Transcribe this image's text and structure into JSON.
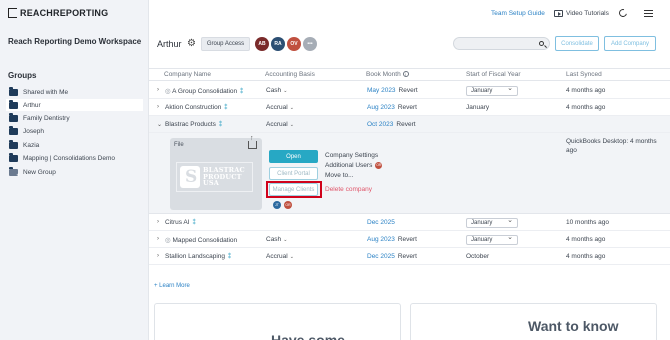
{
  "brand": {
    "name": "REACHREPORTING"
  },
  "sidebar": {
    "workspace": "Reach Reporting Demo Workspace",
    "groups_heading": "Groups",
    "items": [
      {
        "label": "Shared with Me"
      },
      {
        "label": "Arthur"
      },
      {
        "label": "Family Dentistry"
      },
      {
        "label": "Joseph"
      },
      {
        "label": "Kazia"
      },
      {
        "label": "Mapping | Consolidations Demo"
      },
      {
        "label": "New Group"
      }
    ]
  },
  "topbar": {
    "team_setup": "Team Setup Guide",
    "video_tutorials": "Video Tutorials"
  },
  "header": {
    "group_name": "Arthur",
    "group_access": "Group Access",
    "avatars": [
      {
        "initials": "AB",
        "color": "#7a2b2b"
      },
      {
        "initials": "RA",
        "color": "#2c4f73"
      },
      {
        "initials": "OV",
        "color": "#c0503f"
      },
      {
        "initials": "•••",
        "color": "#a6adb6"
      }
    ],
    "search_placeholder": "",
    "consolidate": "Consolidate",
    "add_company": "Add Company"
  },
  "table": {
    "columns": [
      "Company Name",
      "Accounting Basis",
      "Book Month",
      "Start of Fiscal Year",
      "Last Synced"
    ],
    "rows": [
      {
        "name": "A Group Consolidation",
        "basis": "Cash",
        "book": "May 2023",
        "revert": "Revert",
        "fiscal": "January",
        "synced": "4 months ago"
      },
      {
        "name": "Aktion Construction",
        "basis": "Accrual",
        "book": "Aug 2023",
        "revert": "Revert",
        "fiscal": "January",
        "synced": "4 months ago"
      },
      {
        "name": "Blastrac Products",
        "basis": "Accrual",
        "book": "Oct 2023",
        "revert": "Revert",
        "fiscal": "",
        "synced": ""
      },
      {
        "name": "Citrus AI",
        "basis": "",
        "book": "Dec 2025",
        "revert": "",
        "fiscal": "January",
        "synced": "10 months ago"
      },
      {
        "name": "Mapped Consolidation",
        "basis": "Cash",
        "book": "Aug 2023",
        "revert": "Revert",
        "fiscal": "January",
        "synced": "4 months ago"
      },
      {
        "name": "Stallion Landscaping",
        "basis": "Accrual",
        "book": "Dec 2025",
        "revert": "Revert",
        "fiscal": "October",
        "synced": "4 months ago"
      }
    ]
  },
  "expanded": {
    "file_label": "File",
    "logo_lines": [
      "BLASTRAC",
      "PRODUCT",
      "USA"
    ],
    "open": "Open",
    "client_portal": "Client Portal",
    "manage_clients": "Manage Clients",
    "company_settings": "Company Settings",
    "additional_users": "Additional Users",
    "additional_users_badge": "OR",
    "move_to": "Move to...",
    "delete_company": "Delete company",
    "mini_avatars": [
      {
        "initials": "JT",
        "color": "#2c6aa0"
      },
      {
        "initials": "OR",
        "color": "#c0503f"
      }
    ],
    "qb_note": "QuickBooks Desktop: 4 months ago"
  },
  "footer": {
    "learn_more": "+ Learn More",
    "promo_left": "Have some",
    "promo_right": "Want to know"
  }
}
